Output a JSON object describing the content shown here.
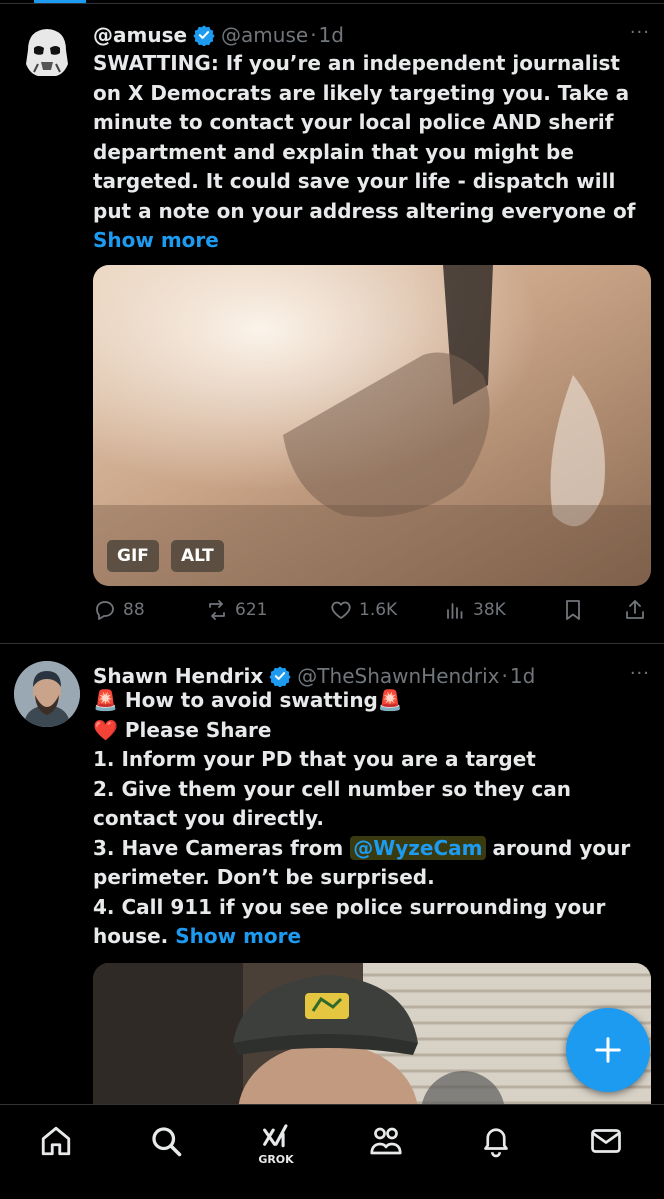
{
  "tweets": [
    {
      "name": "@amuse",
      "handle": "@amuse",
      "separator": "·",
      "time": "1d",
      "more": "···",
      "text": "SWATTING: If you’re an independent journalist on X Democrats are likely targeting you. Take a minute to contact your local police AND sherif department and explain that you might be targeted. It could save your life - dispatch will put a note on your address altering everyone of ",
      "show_more": "Show more",
      "media": {
        "badge_gif": "GIF",
        "badge_alt": "ALT"
      },
      "actions": {
        "replies": "88",
        "reposts": "621",
        "likes": "1.6K",
        "views": "38K"
      }
    },
    {
      "name": "Shawn Hendrix",
      "handle": "@TheShawnHendrix",
      "separator": "·",
      "time": "1d",
      "more": "···",
      "line1_emoji_a": "🚨",
      "line1": " How to avoid swatting",
      "line1_emoji_b": "🚨",
      "line2_emoji": "❤️",
      "line2": " Please Share",
      "line3": "1. Inform your PD that you are a target",
      "line4": "2. Give them your cell number so they can contact you directly.",
      "line5_a": "3. Have Cameras from ",
      "line5_mention": "@WyzeCam",
      "line5_b": " around your perimeter. Don’t be surprised.",
      "line6": "4. Call 911 if you see police surrounding your house. ",
      "show_more": "Show more"
    }
  ],
  "nav": {
    "grok_label": "GROK"
  },
  "icons": [
    "verified-badge-icon",
    "reply-icon",
    "repost-icon",
    "like-icon",
    "views-icon",
    "bookmark-icon",
    "share-icon",
    "plus-icon",
    "home-icon",
    "search-icon",
    "grok-icon",
    "communities-icon",
    "notifications-icon",
    "messages-icon"
  ],
  "colors": {
    "accent": "#1d9bf0",
    "text": "#e7e9ea",
    "muted": "#71767b",
    "background": "#000000"
  }
}
